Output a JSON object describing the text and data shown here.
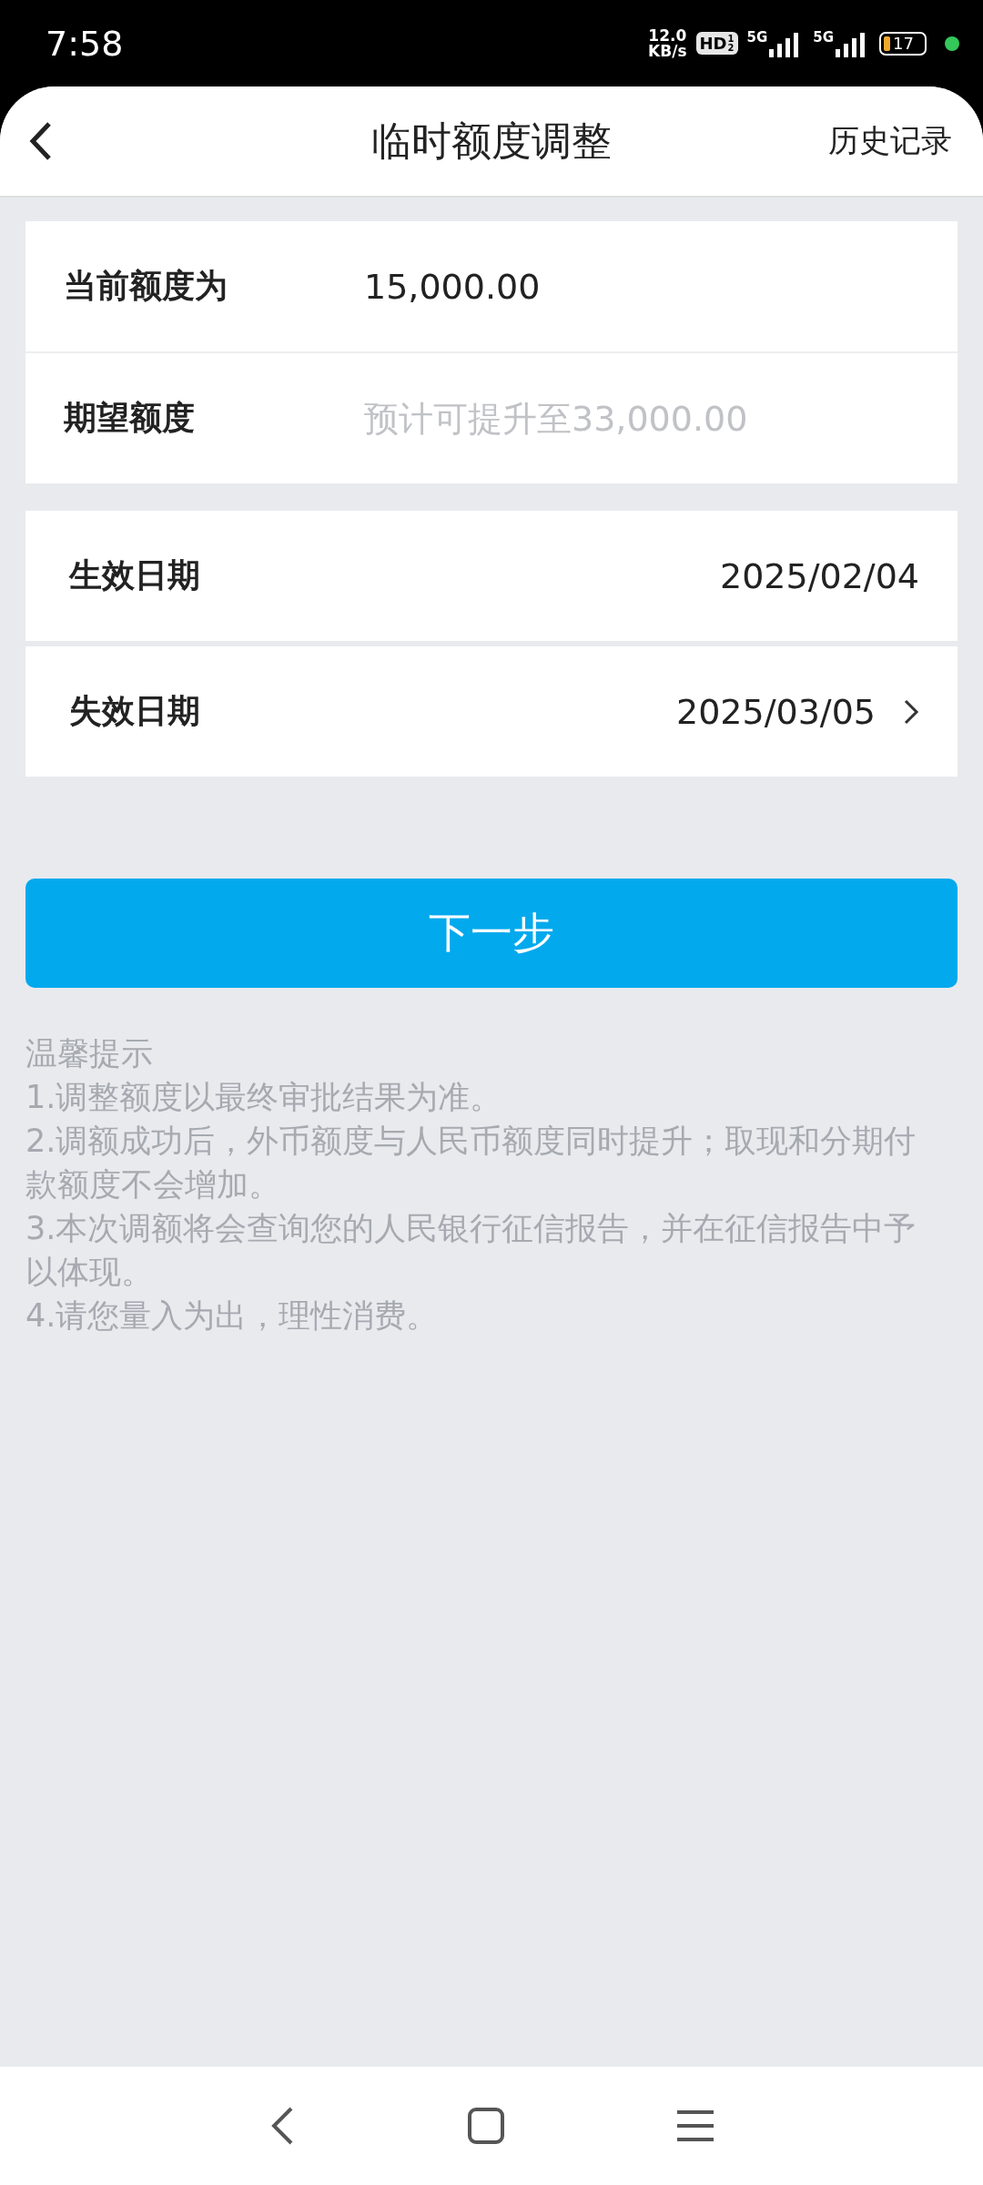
{
  "status_bar": {
    "time": "7:58",
    "speed_value": "12.0",
    "speed_unit": "KB/s",
    "hd": "HD",
    "hd_sub": "1",
    "hd_sub2": "2",
    "sim1": "5G",
    "sim2": "5G",
    "battery": "17"
  },
  "header": {
    "title": "临时额度调整",
    "action": "历史记录"
  },
  "limit_card": {
    "rows": [
      {
        "kind": "text",
        "label": "当前额度为",
        "value": "15,000.00"
      },
      {
        "kind": "input",
        "label": "期望额度",
        "placeholder": "预计可提升至33,000.00"
      }
    ]
  },
  "date_rows": [
    {
      "label": "生效日期",
      "value": "2025/02/04",
      "has_arrow": false
    },
    {
      "label": "失效日期",
      "value": "2025/03/05",
      "has_arrow": true
    }
  ],
  "next_button": "下一步",
  "tips": {
    "title": "温馨提示",
    "items": [
      "1.调整额度以最终审批结果为准。",
      "2.调额成功后，外币额度与人民币额度同时提升；取现和分期付款额度不会增加。",
      "3.本次调额将会查询您的人民银行征信报告，并在征信报告中予以体现。",
      "4.请您量入为出，理性消费。"
    ]
  }
}
